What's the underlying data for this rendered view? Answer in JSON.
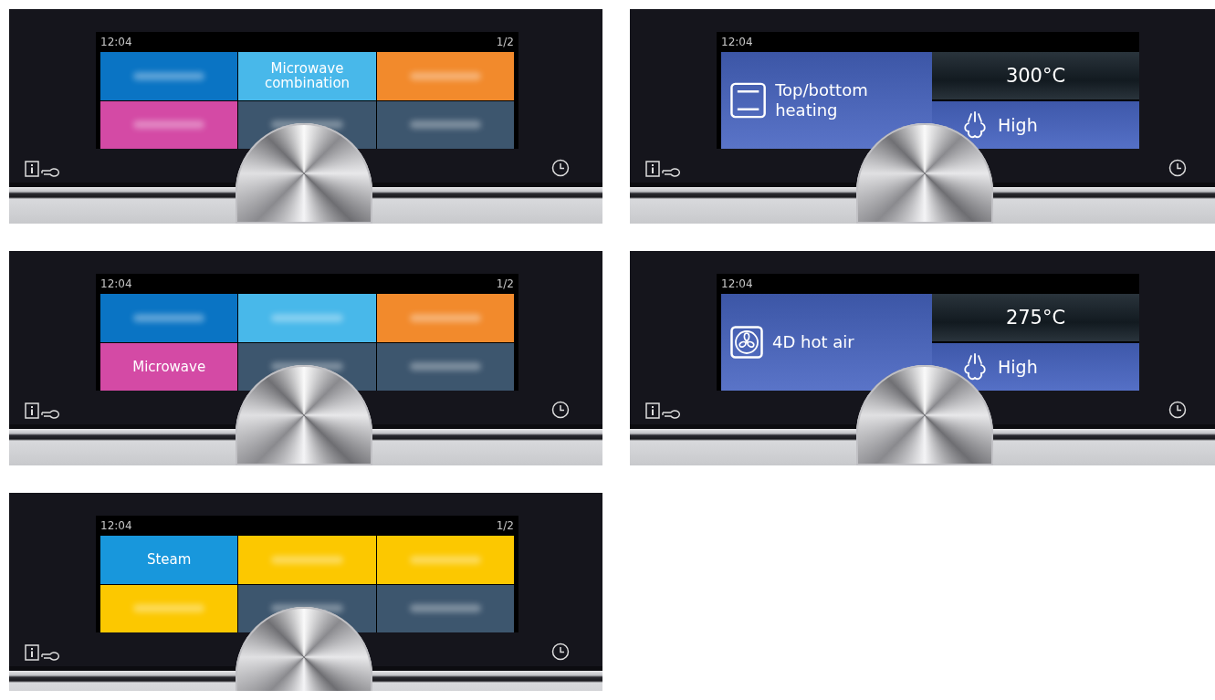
{
  "panels": [
    {
      "kind": "menu",
      "time": "12:04",
      "page": "1/2",
      "tiles": [
        {
          "blurred": true,
          "color": "#0a74c4"
        },
        {
          "blurred": false,
          "label": "Microwave combination",
          "color": "#48b8ea"
        },
        {
          "blurred": true,
          "color": "#f28a2c"
        },
        {
          "blurred": true,
          "color": "#d44aa5"
        },
        {
          "blurred": true,
          "color": "#3d566e"
        },
        {
          "blurred": true,
          "color": "#3d566e"
        }
      ]
    },
    {
      "kind": "detail",
      "time": "12:04",
      "mode": {
        "kind": "top-bottom",
        "label": "Top/bottom heating"
      },
      "temperature": "300°C",
      "steam": "High"
    },
    {
      "kind": "menu",
      "time": "12:04",
      "page": "1/2",
      "tiles": [
        {
          "blurred": true,
          "color": "#0a74c4"
        },
        {
          "blurred": true,
          "color": "#48b8ea"
        },
        {
          "blurred": true,
          "color": "#f28a2c"
        },
        {
          "blurred": false,
          "label": "Microwave",
          "color": "#d44aa5"
        },
        {
          "blurred": true,
          "color": "#3d566e"
        },
        {
          "blurred": true,
          "color": "#3d566e"
        }
      ]
    },
    {
      "kind": "detail",
      "time": "12:04",
      "mode": {
        "kind": "fan",
        "label": "4D hot air"
      },
      "temperature": "275°C",
      "steam": "High"
    },
    {
      "kind": "menu",
      "time": "12:04",
      "page": "1/2",
      "tiles": [
        {
          "blurred": false,
          "label": "Steam",
          "color": "#1897dc"
        },
        {
          "blurred": true,
          "color": "#fcc800"
        },
        {
          "blurred": true,
          "color": "#fcc800"
        },
        {
          "blurred": true,
          "color": "#fcc800"
        },
        {
          "blurred": true,
          "color": "#3d566e"
        },
        {
          "blurred": true,
          "color": "#3d566e"
        }
      ]
    }
  ]
}
